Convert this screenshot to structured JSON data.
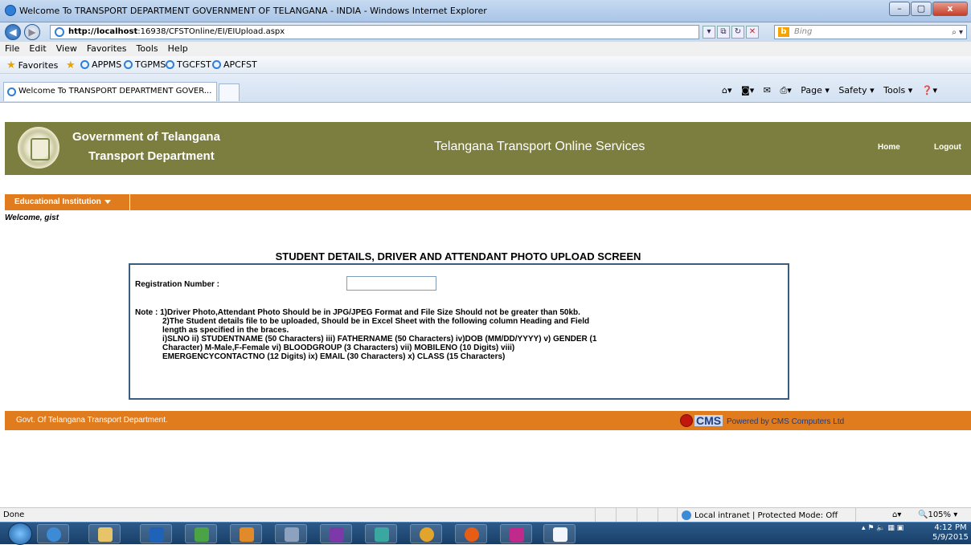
{
  "window": {
    "title": "Welcome To TRANSPORT DEPARTMENT GOVERNMENT OF TELANGANA - INDIA - Windows Internet Explorer",
    "min": "–",
    "max": "▢",
    "close": "x"
  },
  "address": {
    "host": "http://localhost",
    "path": ":16938/CFSTOnline/EI/EIUpload.aspx",
    "search_placeholder": "Bing"
  },
  "menu": [
    "File",
    "Edit",
    "View",
    "Favorites",
    "Tools",
    "Help"
  ],
  "favorites": {
    "label": "Favorites",
    "links": [
      "APPMS",
      "TGPMS",
      "TGCFST",
      "APCFST"
    ]
  },
  "tab": {
    "label": "Welcome To TRANSPORT DEPARTMENT GOVER..."
  },
  "commands": [
    "Page ▾",
    "Safety ▾",
    "Tools ▾"
  ],
  "header": {
    "gov_line1": "Government of Telangana",
    "gov_line2": "Transport Department",
    "service": "Telangana Transport Online Services",
    "home": "Home",
    "logout": "Logout"
  },
  "nav": {
    "menu": "Educational Institution"
  },
  "welcome": "Welcome, gist",
  "form": {
    "title": "STUDENT DETAILS, DRIVER AND ATTENDANT PHOTO UPLOAD SCREEN",
    "reg_label": "Registration Number :",
    "reg_value": "",
    "note_lines": [
      "Note : 1)Driver Photo,Attendant Photo Should be in JPG/JPEG Format and File Size Should not be greater than 50kb.",
      "2)The Student details file to be uploaded, Should be in Excel Sheet with the following column Heading and Field",
      "length as specified in the braces.",
      "i)SLNO ii) STUDENTNAME (50 Characters) iii) FATHERNAME (50 Characters) iv)DOB (MM/DD/YYYY) v) GENDER (1",
      "Character) M-Male,F-Female vi) BLOODGROUP (3 Characters) vii) MOBILENO (10 Digits) viii)",
      "EMERGENCYCONTACTNO (12 Digits) ix) EMAIL (30 Characters) x) CLASS (15 Characters)"
    ]
  },
  "footer": {
    "left": "Govt. Of Telangana Transport Department.",
    "logo": "CMS",
    "powered": "Powered by CMS Computers Ltd"
  },
  "status": {
    "text": "Done",
    "zone": "Local intranet | Protected Mode: Off",
    "zoom": "105%"
  },
  "taskbar": {
    "time": "4:12 PM",
    "date": "5/9/2015"
  }
}
